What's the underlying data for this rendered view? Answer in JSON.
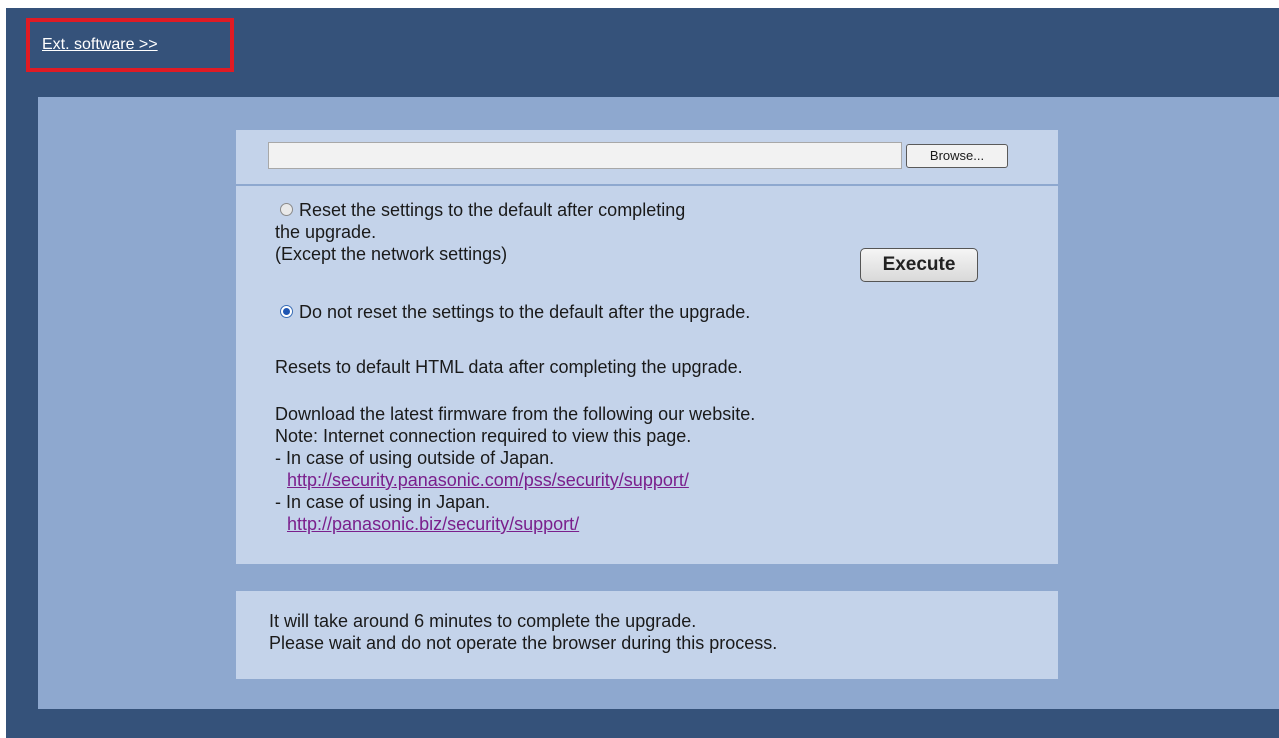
{
  "header": {
    "ext_software_link": "Ext. software >>"
  },
  "upgrade": {
    "browse_label": "Browse...",
    "execute_label": "Execute",
    "options": [
      {
        "line1": "Reset the settings to the default after completing",
        "line2": "the upgrade.",
        "line3": "(Except the network settings)",
        "selected": false
      },
      {
        "line1": "Do not reset the settings to the default after the upgrade.",
        "selected": true
      }
    ],
    "reset_html_note": "Resets to default HTML data after completing the upgrade.",
    "download": {
      "line1": "Download the latest firmware from the following our website.",
      "line2": "Note: Internet connection required to view this page.",
      "outside_japan_label": "- In case of using outside of Japan.",
      "outside_japan_url": "http://security.panasonic.com/pss/security/support/",
      "in_japan_label": "- In case of using in Japan.",
      "in_japan_url": "http://panasonic.biz/security/support/"
    }
  },
  "notice": {
    "line1": "It will take around 6 minutes to complete the upgrade.",
    "line2": "Please wait and do not operate the browser during this process."
  }
}
